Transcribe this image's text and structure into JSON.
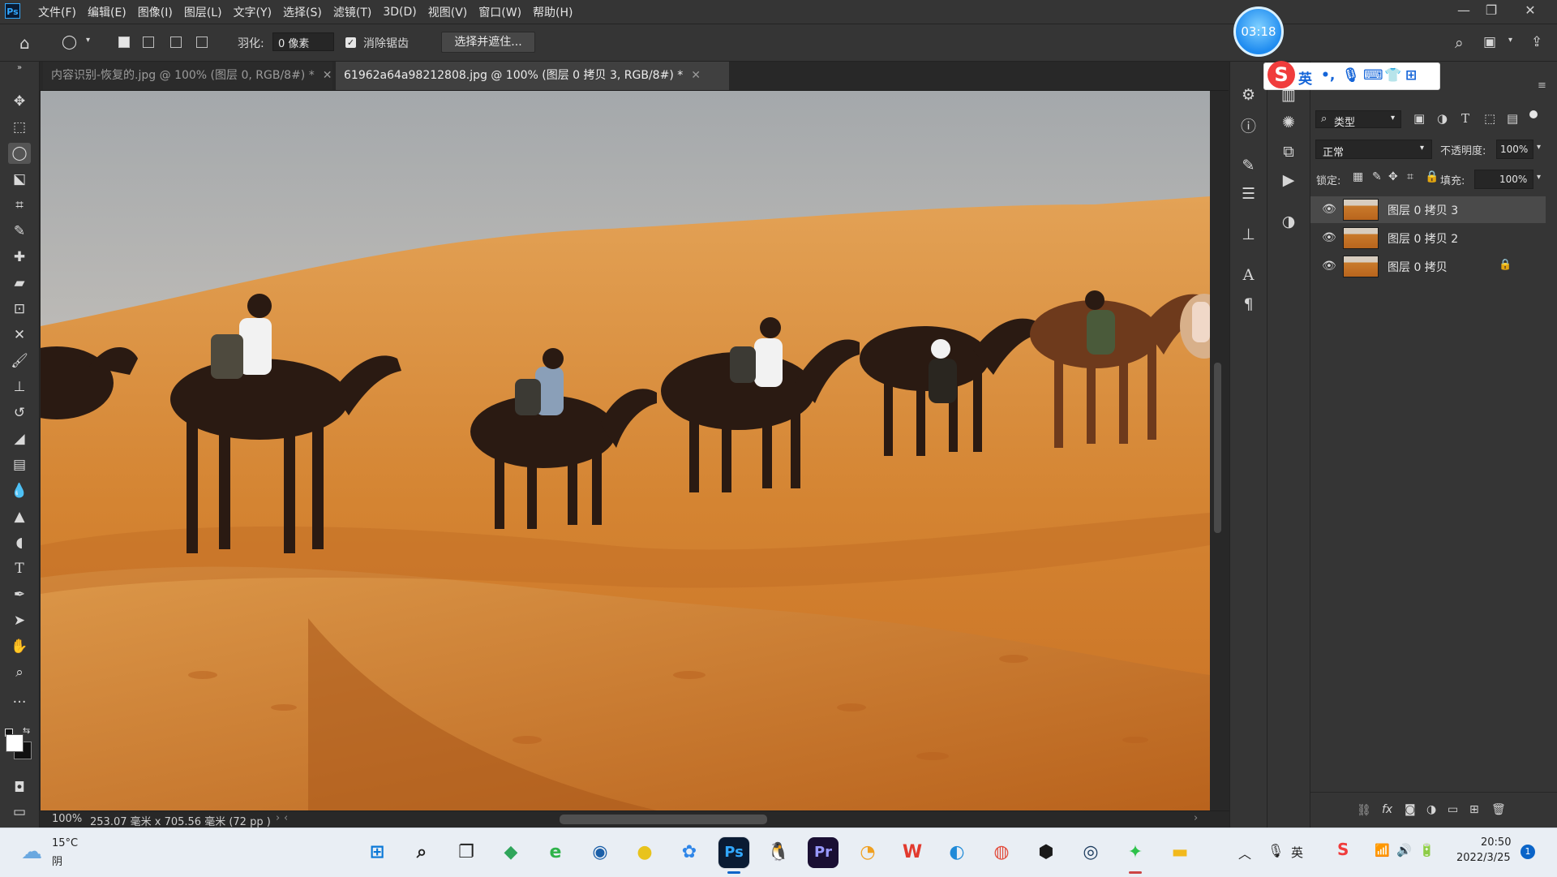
{
  "app": {
    "logo": "Ps"
  },
  "menu": [
    "文件(F)",
    "编辑(E)",
    "图像(I)",
    "图层(L)",
    "文字(Y)",
    "选择(S)",
    "滤镜(T)",
    "3D(D)",
    "视图(V)",
    "窗口(W)",
    "帮助(H)"
  ],
  "options": {
    "feather_label": "羽化:",
    "feather_value": "0 像素",
    "antialias_label": "消除锯齿",
    "antialias_checked": true,
    "select_mask_label": "选择并遮住..."
  },
  "timer": "03:18",
  "ime": {
    "lang": "英"
  },
  "tabs": [
    {
      "label": "内容识别-恢复的.jpg @ 100% (图层 0, RGB/8#) *",
      "active": false
    },
    {
      "label": "61962a64a98212808.jpg @ 100% (图层 0 拷贝 3, RGB/8#) *",
      "active": true
    }
  ],
  "status": {
    "zoom": "100%",
    "doc_size": "253.07 毫米 x 705.56 毫米 (72 pp )"
  },
  "layers_panel": {
    "filter_kind": "类型",
    "blend_mode": "正常",
    "opacity_label": "不透明度:",
    "opacity_value": "100%",
    "lock_label": "锁定:",
    "fill_label": "填充:",
    "fill_value": "100%",
    "layers": [
      {
        "name": "图层 0 拷贝 3",
        "selected": true,
        "locked": false
      },
      {
        "name": "图层 0 拷贝 2",
        "selected": false,
        "locked": false
      },
      {
        "name": "图层 0 拷贝",
        "selected": false,
        "locked": true
      }
    ]
  },
  "taskbar": {
    "weather_temp": "15°C",
    "weather_desc": "阴",
    "tray_lang": "英",
    "time": "20:50",
    "date": "2022/3/25",
    "notifications": "1",
    "apps": [
      {
        "name": "start-icon",
        "glyph": "⊞",
        "color": "#0a78d7"
      },
      {
        "name": "search-icon",
        "glyph": "⌕",
        "color": "#222222"
      },
      {
        "name": "task-view-icon",
        "glyph": "❐",
        "color": "#222222"
      },
      {
        "name": "app-folder-green-icon",
        "glyph": "◆",
        "color": "#2fa55a"
      },
      {
        "name": "app-360-browser-icon",
        "glyph": "e",
        "color": "#2fb34a"
      },
      {
        "name": "app-globe-icon",
        "glyph": "◉",
        "color": "#1b5fa8"
      },
      {
        "name": "app-yellow-icon",
        "glyph": "●",
        "color": "#e8c31c"
      },
      {
        "name": "app-baidu-netdisk-icon",
        "glyph": "✿",
        "color": "#2f86e8"
      },
      {
        "name": "photoshop-icon",
        "glyph": "Ps",
        "color": "#31a8ff"
      },
      {
        "name": "qq-icon",
        "glyph": "🐧",
        "color": "#111111"
      },
      {
        "name": "premiere-icon",
        "glyph": "Pr",
        "color": "#9999ff"
      },
      {
        "name": "app-orange-icon",
        "glyph": "◔",
        "color": "#f0a020"
      },
      {
        "name": "wps-icon",
        "glyph": "W",
        "color": "#e23a2e"
      },
      {
        "name": "edge-icon",
        "glyph": "◐",
        "color": "#1f8ad8"
      },
      {
        "name": "chrome-icon",
        "glyph": "◍",
        "color": "#e24a3a"
      },
      {
        "name": "app-shield-icon",
        "glyph": "⬢",
        "color": "#1a1a1a"
      },
      {
        "name": "steam-icon",
        "glyph": "◎",
        "color": "#1b3a5c"
      },
      {
        "name": "wechat-icon",
        "glyph": "✦",
        "color": "#2dc24a"
      },
      {
        "name": "file-explorer-icon",
        "glyph": "▬",
        "color": "#f2b91c"
      }
    ]
  }
}
